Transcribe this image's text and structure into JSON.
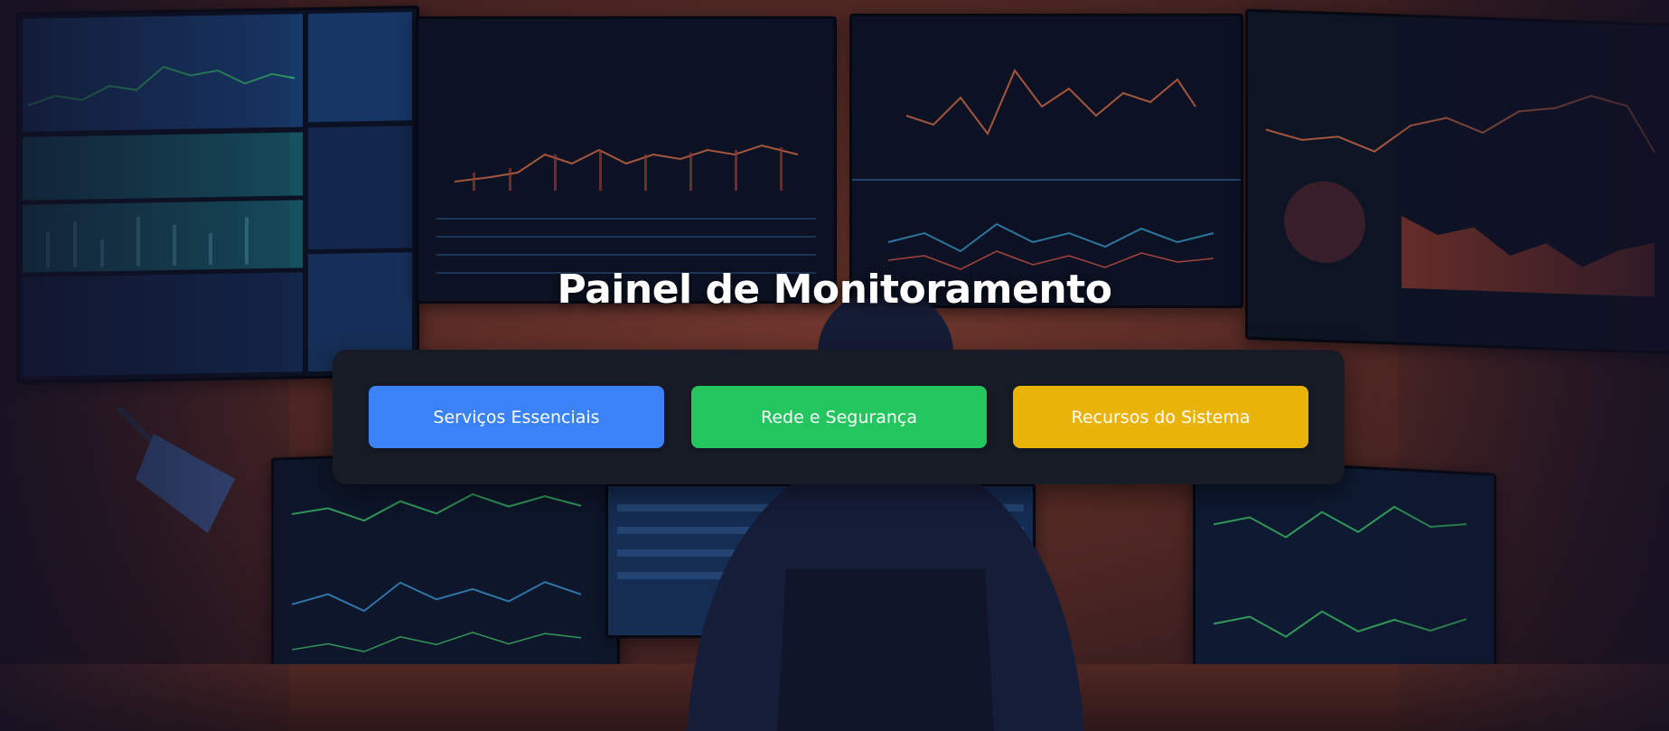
{
  "page": {
    "title": "Painel de Monitoramento"
  },
  "menu": {
    "buttons": [
      {
        "label": "Serviços Essenciais",
        "color": "#3b82f6"
      },
      {
        "label": "Rede e Segurança",
        "color": "#22c55e"
      },
      {
        "label": "Recursos do Sistema",
        "color": "#eab308"
      }
    ]
  },
  "panel": {
    "background": "#161b26"
  },
  "background": {
    "description_icon": "trading-room-illustration"
  }
}
